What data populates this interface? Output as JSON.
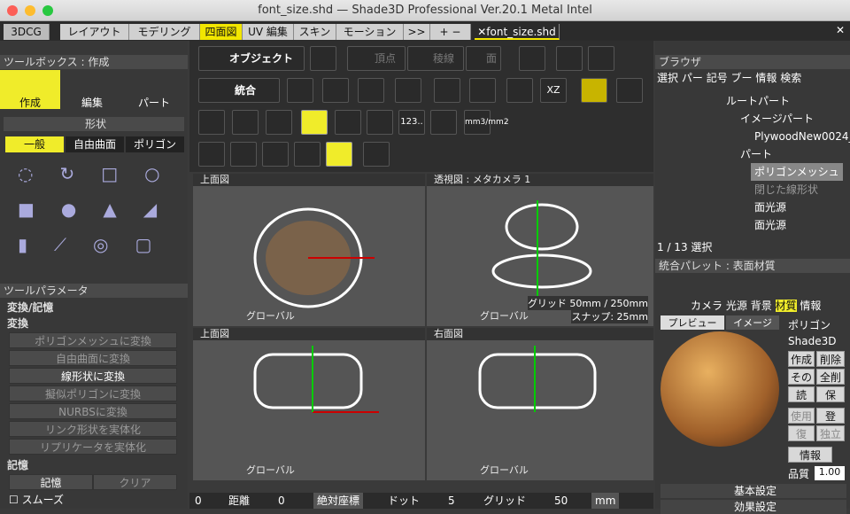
{
  "window": {
    "title": "font_size.shd — Shade3D Professional Ver.20.1 Metal Intel"
  },
  "tabs": [
    "3DCG",
    "レイアウト",
    "モデリング",
    "四面図",
    "UV 編集",
    "スキン",
    "モーション",
    ">>",
    "+ −",
    "✕font_size.shd",
    "✕"
  ],
  "toolbox": {
    "title": "ツールボックス : 作成",
    "modes": [
      "作成",
      "編集",
      "パート"
    ],
    "section": "形状",
    "shape_tabs": [
      "一般",
      "自由曲面",
      "ポリゴン"
    ]
  },
  "params": {
    "title": "ツールパラメータ",
    "section": "変換/記憶",
    "sub1": "変換",
    "buttons": [
      "ポリゴンメッシュに変換",
      "自由曲面に変換",
      "線形状に変換",
      "擬似ポリゴンに変換",
      "NURBSに変換",
      "リンク形状を実体化",
      "リプリケータを実体化"
    ],
    "sub2": "記憶",
    "memo": [
      "記憶",
      "クリア"
    ],
    "smooth": "スムーズ"
  },
  "toolbar": {
    "object": "オブジェクト",
    "vertex": "頂点",
    "edge": "稜線",
    "face": "面",
    "merge": "統合",
    "xz": "XZ",
    "num": "123..",
    "mm": "mm3/mm2"
  },
  "viewports": [
    {
      "title": "上面図",
      "footer": "グローバル"
    },
    {
      "title": "透視図 : メタカメラ 1",
      "footer": "グローバル",
      "grid": "グリッド 50mm / 250mm",
      "snap": "スナップ: 25mm"
    },
    {
      "title": "上面図",
      "footer": "グローバル"
    },
    {
      "title": "右面図",
      "footer": "グローバル"
    }
  ],
  "statusbar": {
    "items": [
      "0",
      "距離",
      "0",
      "絶対座標",
      "ドット",
      "5",
      "グリッド",
      "50",
      "mm"
    ]
  },
  "browser": {
    "title": "ブラウザ",
    "tabs": [
      "選択",
      "パー",
      "記号",
      "ブー",
      "情報",
      "検索"
    ],
    "items": [
      "ルートパート",
      "イメージパート",
      "PlywoodNew0024_",
      "パート",
      "ポリゴンメッシュ",
      "閉じた線形状",
      "面光源",
      "面光源"
    ],
    "count": "1 / 13 選択"
  },
  "palette": {
    "title": "統合パレット : 表面材質",
    "icons": [
      "カメラ",
      "光源",
      "背景",
      "材質",
      "情報"
    ],
    "tabs": [
      "プレビュー",
      "イメージ"
    ],
    "type": "ポリゴン",
    "renderer": "Shade3D",
    "btns": [
      "作成",
      "削除",
      "その",
      "全削",
      "読",
      "保",
      "使用",
      "登",
      "復",
      "独立"
    ],
    "info": "情報",
    "quality_label": "品質",
    "quality": "1.00",
    "sections": [
      "基本設定",
      "効果設定"
    ]
  }
}
